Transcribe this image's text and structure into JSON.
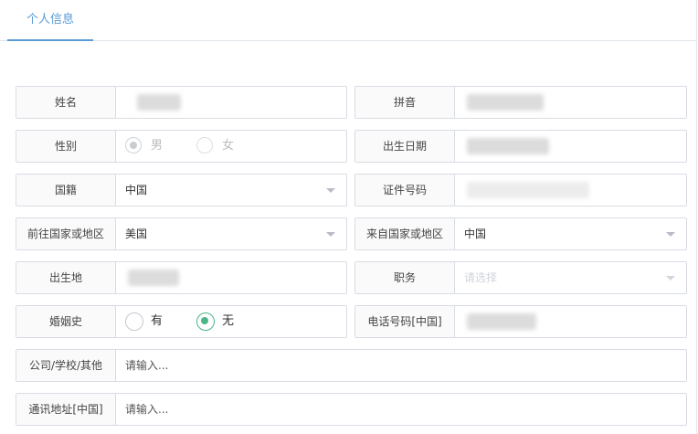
{
  "tabs": {
    "active": "个人信息"
  },
  "fields": {
    "name": {
      "label": "姓名"
    },
    "pinyin": {
      "label": "拼音"
    },
    "gender": {
      "label": "性别",
      "options": [
        "男",
        "女"
      ],
      "selected": "男"
    },
    "birth_date": {
      "label": "出生日期"
    },
    "nationality": {
      "label": "国籍",
      "value": "中国"
    },
    "id_number": {
      "label": "证件号码"
    },
    "destination": {
      "label": "前往国家或地区",
      "value": "美国"
    },
    "origin": {
      "label": "来自国家或地区",
      "value": "中国"
    },
    "birthplace": {
      "label": "出生地"
    },
    "position": {
      "label": "职务",
      "placeholder": "请选择"
    },
    "marital_history": {
      "label": "婚姻史",
      "options": [
        "有",
        "无"
      ],
      "selected": "无"
    },
    "phone": {
      "label": "电话号码[中国]"
    },
    "company": {
      "label": "公司/学校/其他",
      "placeholder": "请输入..."
    },
    "address": {
      "label": "通讯地址[中国]",
      "placeholder": "请输入..."
    }
  },
  "colors": {
    "accent_tab": "#5a9bd5",
    "radio_checked": "#4bb58a",
    "border": "#d8dce3"
  }
}
